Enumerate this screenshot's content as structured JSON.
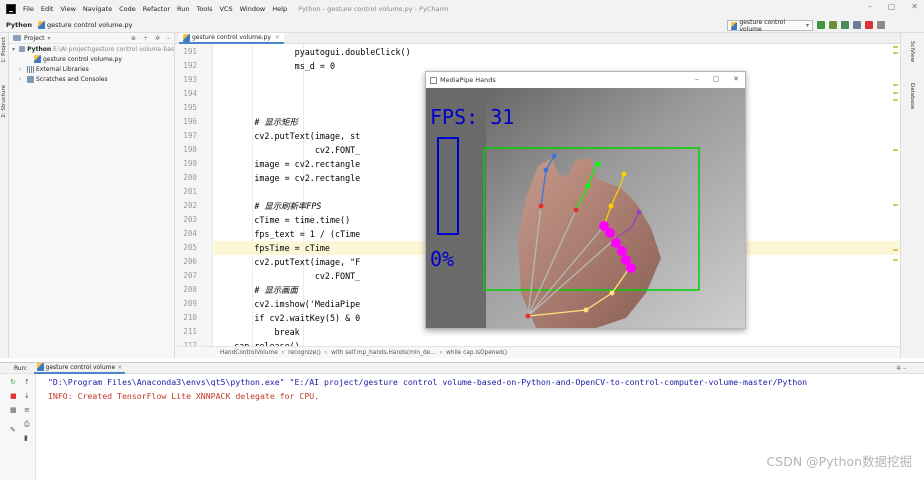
{
  "titlebar": {
    "menu": [
      "File",
      "Edit",
      "View",
      "Navigate",
      "Code",
      "Refactor",
      "Run",
      "Tools",
      "VCS",
      "Window",
      "Help"
    ],
    "window_title": "Python - gesture control volume.py - PyCharm",
    "controls": [
      "–",
      "▢",
      "✕"
    ]
  },
  "navbar": {
    "project": "Python",
    "file": "gesture control volume.py",
    "run_config": "gesture control volume"
  },
  "project_panel": {
    "header": "Project",
    "tree": [
      {
        "label": "Python",
        "detail": "E:\\AI project\\gesture control volume-bas",
        "indent": 0,
        "icon": "folder-icon"
      },
      {
        "label": "gesture control volume.py",
        "detail": "",
        "indent": 2,
        "icon": "python-file-icon"
      },
      {
        "label": "External Libraries",
        "detail": "",
        "indent": 1,
        "icon": "library-icon"
      },
      {
        "label": "Scratches and Consoles",
        "detail": "",
        "indent": 1,
        "icon": "scratch-icon"
      }
    ]
  },
  "side_labels": {
    "left": [
      "1: Project",
      "2: Structure"
    ],
    "right": [
      "SciView",
      "Database"
    ]
  },
  "editor": {
    "tab": "gesture control volume.py",
    "lines": [
      {
        "n": "191",
        "code": "                pyautogui.doubleClick()",
        "hl": false
      },
      {
        "n": "192",
        "code": "                ms_d = 0",
        "hl": false
      },
      {
        "n": "193",
        "code": "",
        "hl": false
      },
      {
        "n": "194",
        "code": "",
        "hl": false
      },
      {
        "n": "195",
        "code": "",
        "hl": false
      },
      {
        "n": "196",
        "code": "        # 显示矩形",
        "hl": false,
        "comment": true
      },
      {
        "n": "197",
        "code": "        cv2.putText(image, st",
        "hl": false
      },
      {
        "n": "198",
        "code": "                    cv2.FONT_",
        "hl": false
      },
      {
        "n": "199",
        "code": "        image = cv2.rectangle",
        "hl": false
      },
      {
        "n": "200",
        "code": "        image = cv2.rectangle                                    5, 0, 0), -1)",
        "hl": false
      },
      {
        "n": "201",
        "code": "",
        "hl": false
      },
      {
        "n": "202",
        "code": "        # 显示刷新率FPS",
        "hl": false,
        "comment": true
      },
      {
        "n": "203",
        "code": "        cTime = time.time()",
        "hl": false
      },
      {
        "n": "204",
        "code": "        fps_text = 1 / (cTime",
        "hl": false
      },
      {
        "n": "205",
        "code": "        fpsTime = cTime",
        "hl": true
      },
      {
        "n": "206",
        "code": "        cv2.putText(image, \"F",
        "hl": false
      },
      {
        "n": "207",
        "code": "                    cv2.FONT_",
        "hl": false
      },
      {
        "n": "208",
        "code": "        # 显示画面",
        "hl": false,
        "comment": true
      },
      {
        "n": "209",
        "code": "        cv2.imshow('MediaPipe",
        "hl": false
      },
      {
        "n": "210",
        "code": "        if cv2.waitKey(5) & 0",
        "hl": false
      },
      {
        "n": "211",
        "code": "            break",
        "hl": false
      },
      {
        "n": "212",
        "code": "    cap.release()",
        "hl": false
      }
    ],
    "breadcrumb": [
      "HandControlVolume",
      "recognize()",
      "with self.mp_hands.Hands(min_de...",
      "while cap.isOpened()"
    ]
  },
  "mediapipe_window": {
    "title": "MediaPipe Hands",
    "fps_label": "FPS: 31",
    "volume_percent": "0%",
    "controls": [
      "–",
      "▢",
      "✕"
    ]
  },
  "run_panel": {
    "label": "Run:",
    "tab": "gesture control volume",
    "lines": [
      {
        "text": "\"D:\\Program Files\\Anaconda3\\envs\\qt5\\python.exe\" \"E:/AI project/gesture control volume-based-on-Python-and-OpenCV-to-control-computer-volume-master/Python",
        "color": "#1a1aa6"
      },
      {
        "text": "INFO: Created TensorFlow Lite XNNPACK delegate for CPU.",
        "color": "#c0392b"
      }
    ]
  },
  "watermark": "CSDN @Python数据挖掘",
  "colors": {
    "accent": "#4a86c8",
    "fps_blue": "#0000cc",
    "box_green": "#00d000",
    "landmark_magenta": "#ff00ff"
  }
}
